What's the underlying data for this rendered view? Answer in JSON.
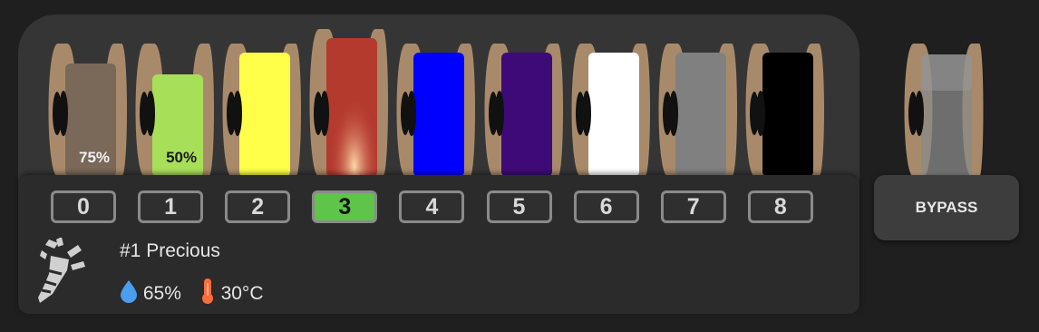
{
  "gates": [
    {
      "label": "0",
      "color": "#7a6858",
      "fill": "75%",
      "text_color": "#f2f2f2",
      "active": false
    },
    {
      "label": "1",
      "color": "#a8df58",
      "fill": "50%",
      "text_color": "#1a1a1a",
      "active": false
    },
    {
      "label": "2",
      "color": "#ffff4a",
      "fill": "",
      "text_color": "#000",
      "active": false
    },
    {
      "label": "3",
      "color": "#b43a2e",
      "fill": "",
      "text_color": "#000",
      "active": true
    },
    {
      "label": "4",
      "color": "#0000ff",
      "fill": "",
      "text_color": "#000",
      "active": false
    },
    {
      "label": "5",
      "color": "#3e0a78",
      "fill": "",
      "text_color": "#000",
      "active": false
    },
    {
      "label": "6",
      "color": "#ffffff",
      "fill": "",
      "text_color": "#000",
      "active": false
    },
    {
      "label": "7",
      "color": "#808080",
      "fill": "",
      "text_color": "#000",
      "active": false
    },
    {
      "label": "8",
      "color": "#000000",
      "fill": "",
      "text_color": "#000",
      "active": false
    }
  ],
  "bypass": {
    "label": "BYPASS"
  },
  "tool": {
    "name": "#1 Precious",
    "humidity": "65%",
    "temperature": "30°C"
  },
  "colors": {
    "background": "#1f1f1f",
    "unit": "#353535",
    "tray": "#2b2b2b",
    "flange": "#a88a6a",
    "active_gate": "#5ec44a",
    "humidity_icon": "#4a9df0",
    "temp_icon": "#ff6b3d"
  },
  "icons": {
    "tool": "extruder-nozzle-icon",
    "humidity": "droplet-icon",
    "temperature": "thermometer-icon"
  }
}
